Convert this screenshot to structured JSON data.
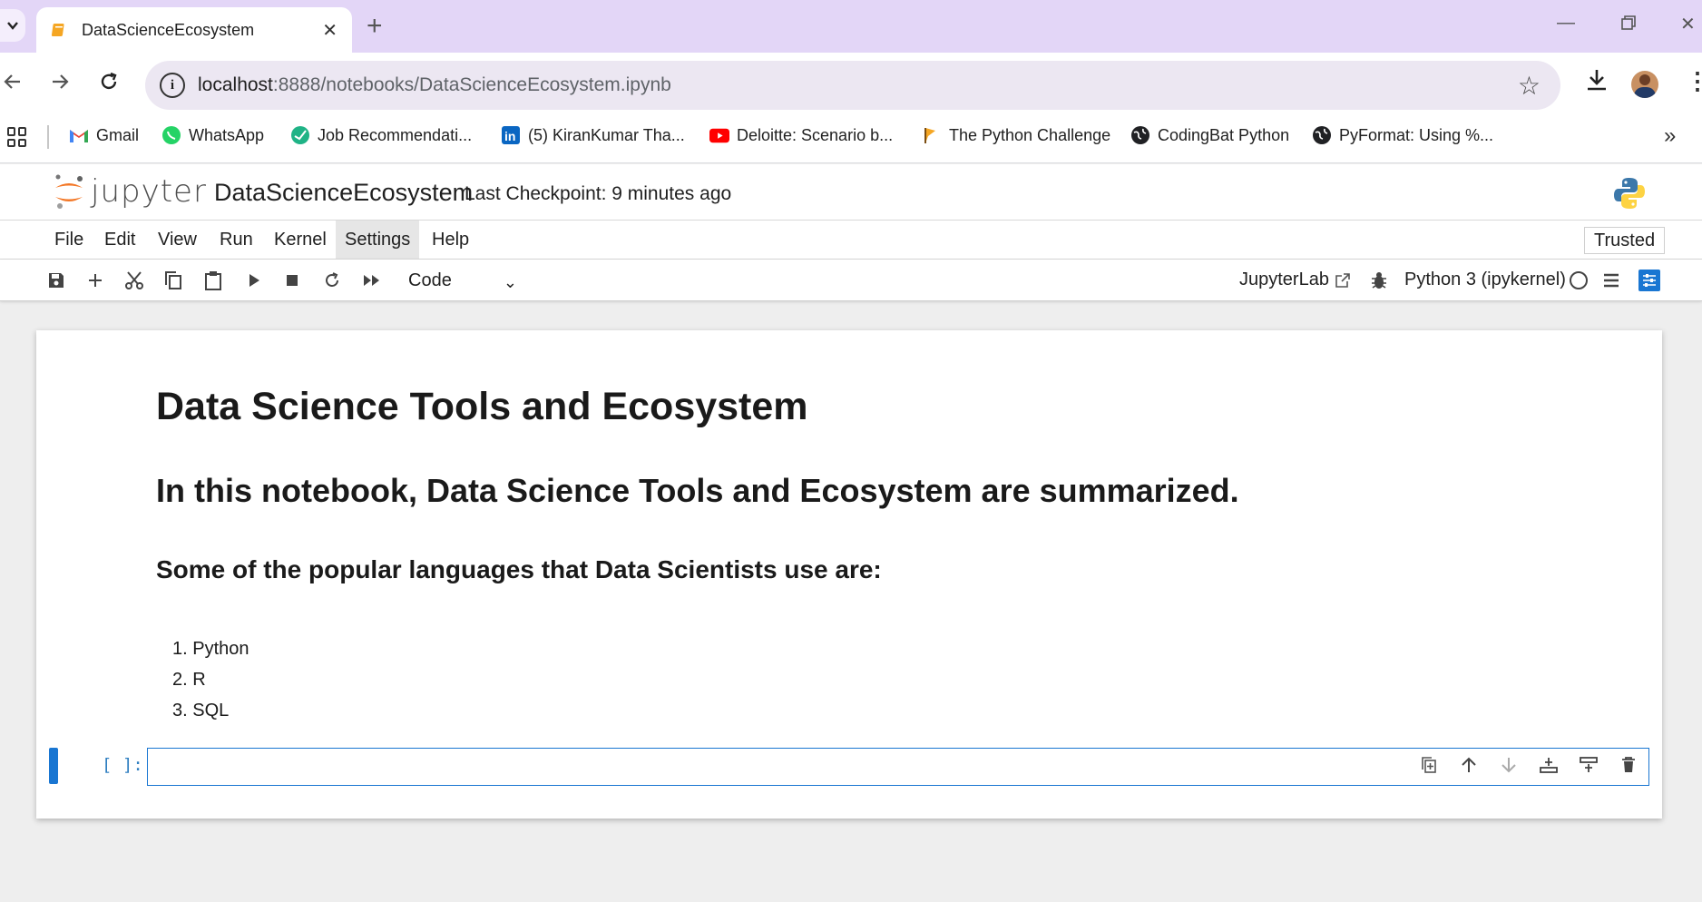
{
  "browser": {
    "tab_title": "DataScienceEcosystem",
    "url_host": "localhost",
    "url_rest": ":8888/notebooks/DataScienceEcosystem.ipynb",
    "bookmarks": [
      {
        "label": "Gmail",
        "icon": "gmail-icon"
      },
      {
        "label": "WhatsApp",
        "icon": "whatsapp-icon"
      },
      {
        "label": "Job Recommendati...",
        "icon": "job-icon"
      },
      {
        "label": "(5) KiranKumar Tha...",
        "icon": "linkedin-icon"
      },
      {
        "label": "Deloitte: Scenario b...",
        "icon": "youtube-icon"
      },
      {
        "label": "The Python Challenge",
        "icon": "python-challenge-icon"
      },
      {
        "label": "CodingBat Python",
        "icon": "globe-icon"
      },
      {
        "label": "PyFormat: Using %...",
        "icon": "globe-icon"
      }
    ]
  },
  "jupyter": {
    "logo_text": "jupyter",
    "notebook_name": "DataScienceEcosystem",
    "checkpoint": "Last Checkpoint: 9 minutes ago",
    "menu": [
      "File",
      "Edit",
      "View",
      "Run",
      "Kernel",
      "Settings",
      "Help"
    ],
    "active_menu": "Settings",
    "trusted": "Trusted",
    "cell_type": "Code",
    "jupyterlab_link": "JupyterLab",
    "kernel": "Python 3 (ipykernel)"
  },
  "notebook": {
    "h1": "Data Science Tools and Ecosystem",
    "h2": "In this notebook, Data Science Tools and Ecosystem are summarized.",
    "h3": "Some of the popular languages that Data Scientists use are:",
    "languages": [
      "1. Python",
      "2. R",
      "3. SQL"
    ],
    "code_prompt": "[ ]:",
    "code_value": ""
  },
  "colors": {
    "accent": "#1976d2",
    "tabstrip": "#e3d6f7",
    "jupyter_orange": "#f37726"
  }
}
